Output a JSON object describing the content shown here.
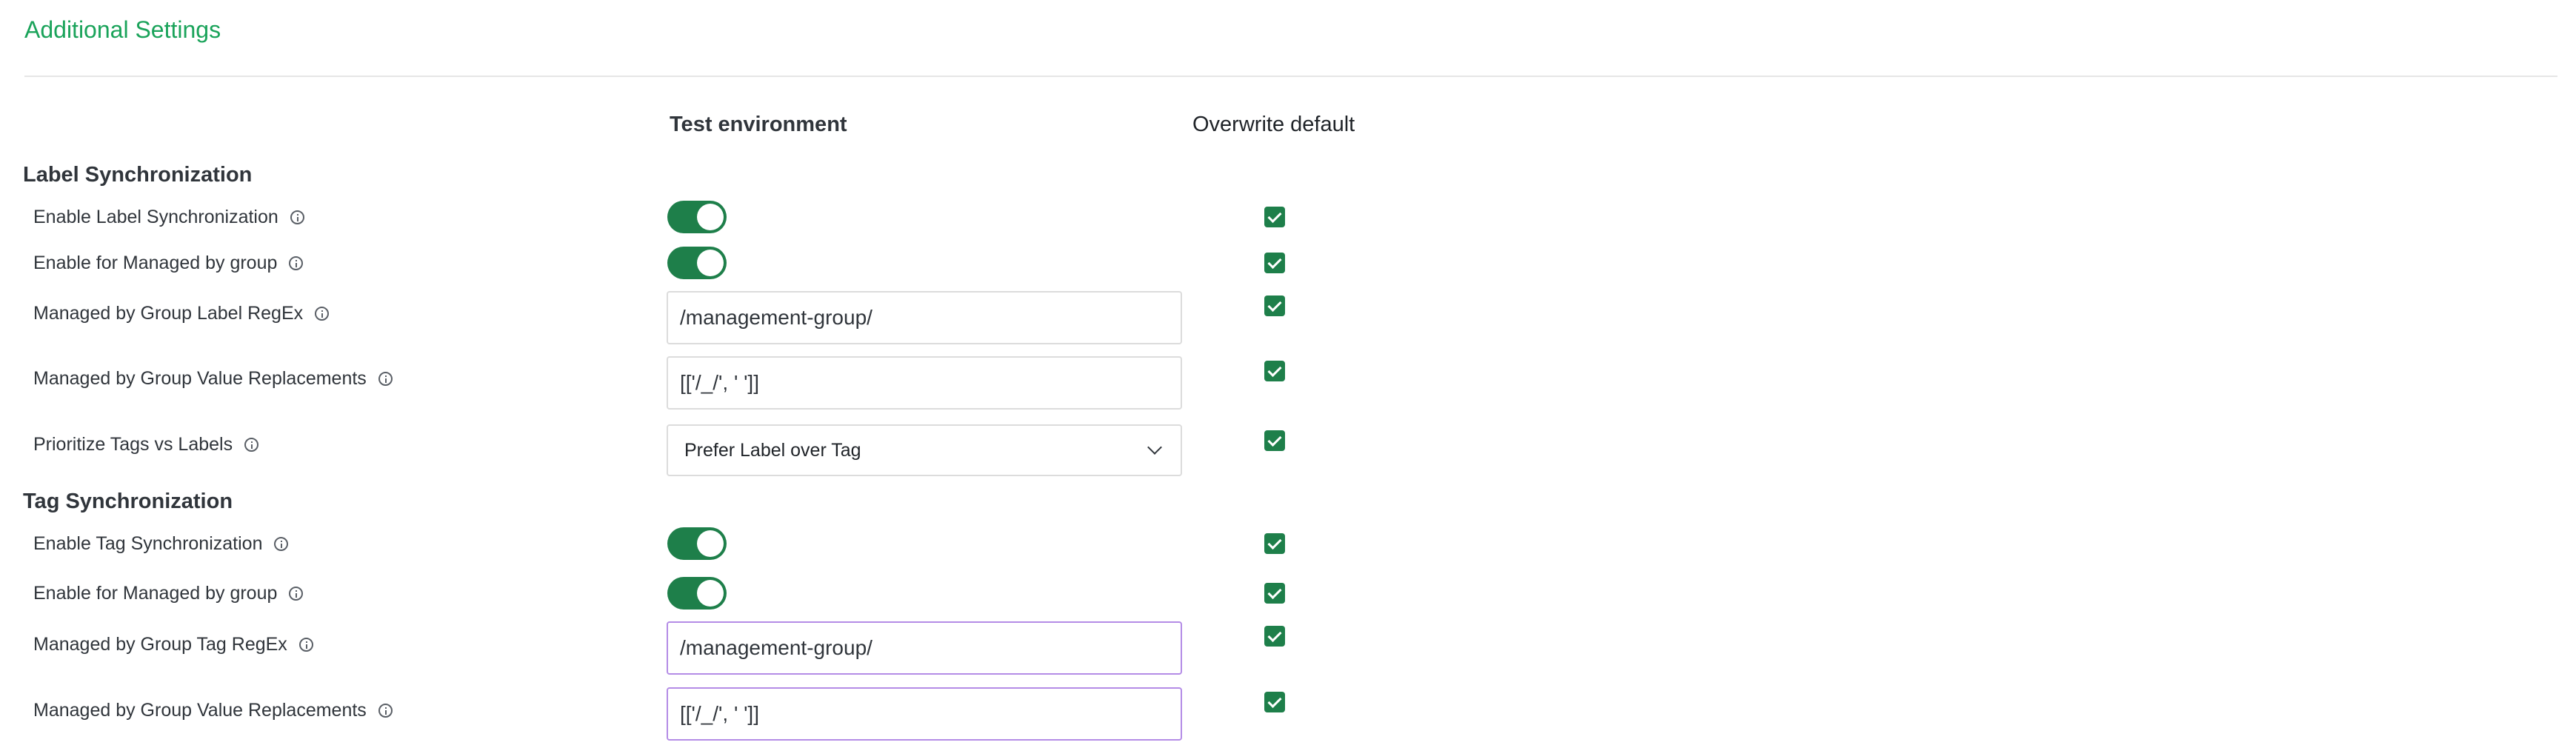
{
  "section": {
    "title": "Additional Settings"
  },
  "columns": {
    "test": "Test environment",
    "overwrite": "Overwrite default"
  },
  "groups": {
    "label": {
      "title": "Label Synchronization",
      "rows": [
        {
          "label": "Enable Label Synchronization",
          "type": "toggle",
          "value": true,
          "overwrite": true
        },
        {
          "label": "Enable for Managed by group",
          "type": "toggle",
          "value": true,
          "overwrite": true
        },
        {
          "label": "Managed by Group Label RegEx",
          "type": "text",
          "value": "/management-group/",
          "overwrite": true
        },
        {
          "label": "Managed by Group Value Replacements",
          "type": "text",
          "value": "[['/_/', ' ']]",
          "overwrite": true
        },
        {
          "label": "Prioritize Tags vs Labels",
          "type": "select",
          "value": "Prefer Label over Tag",
          "overwrite": true
        }
      ]
    },
    "tag": {
      "title": "Tag Synchronization",
      "rows": [
        {
          "label": "Enable Tag Synchronization",
          "type": "toggle",
          "value": true,
          "overwrite": true
        },
        {
          "label": "Enable for Managed by group",
          "type": "toggle",
          "value": true,
          "overwrite": true
        },
        {
          "label": "Managed by Group Tag RegEx",
          "type": "text",
          "value": "/management-group/",
          "overwrite": true
        },
        {
          "label": "Managed by Group Value Replacements",
          "type": "text",
          "value": "[['/_/', ' ']]",
          "overwrite": true
        }
      ]
    }
  },
  "icons": {
    "info": "info-circle-icon",
    "chevron": "chevron-down-icon",
    "check": "check-icon"
  },
  "colors": {
    "accent": "#1aa35a",
    "toggle_on": "#1e7f4a",
    "checkbox": "#1e7f4a",
    "focus_border": "#b48ce6"
  }
}
